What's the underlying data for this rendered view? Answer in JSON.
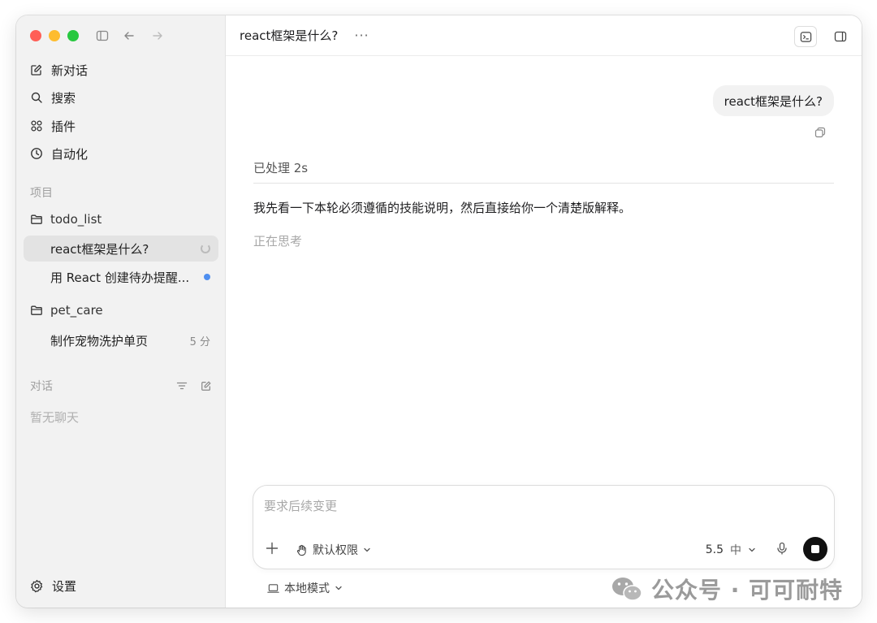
{
  "sidebar": {
    "nav": {
      "new_chat": "新对话",
      "search": "搜索",
      "plugins": "插件",
      "automation": "自动化"
    },
    "projects_label": "项目",
    "projects": [
      {
        "name": "todo_list",
        "threads": [
          {
            "title": "react框架是什么?",
            "status": "running"
          },
          {
            "title": "用 React 创建待办提醒...",
            "status": "unread"
          }
        ]
      },
      {
        "name": "pet_care",
        "threads": [
          {
            "title": "制作宠物洗护单页",
            "meta": "5 分"
          }
        ]
      }
    ],
    "chats_label": "对话",
    "no_chats": "暂无聊天",
    "settings": "设置"
  },
  "header": {
    "title": "react框架是什么?",
    "more": "···"
  },
  "conversation": {
    "user_message": "react框架是什么?",
    "processed": "已处理 2s",
    "answer": "我先看一下本轮必须遵循的技能说明，然后直接给你一个清楚版解释。",
    "thinking": "正在思考"
  },
  "composer": {
    "placeholder": "要求后续变更",
    "permission": "默认权限",
    "model": "5.5",
    "effort": "中",
    "mode": "本地模式"
  },
  "watermark": {
    "text": "公众号 · 可可耐特"
  },
  "colors": {
    "accent_blue": "#4f8ff0",
    "sidebar_bg": "#f2f2f2",
    "close": "#ff5f57",
    "minimize": "#febc2e",
    "zoom": "#28c840"
  }
}
